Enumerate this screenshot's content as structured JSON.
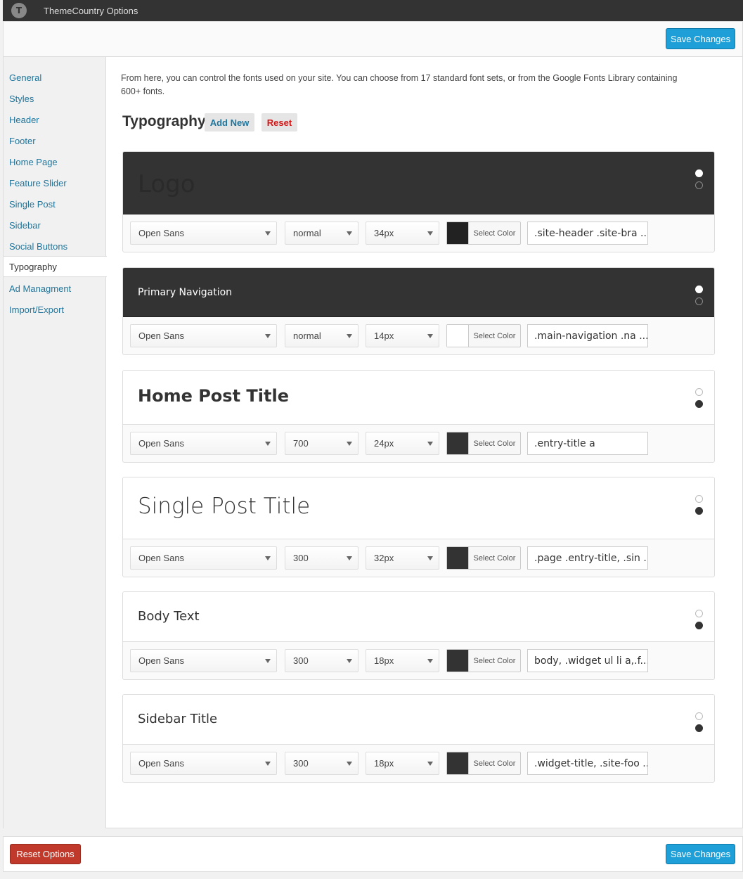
{
  "app": {
    "title": "ThemeCountry Options",
    "logo_glyph": "T"
  },
  "header": {
    "save_label": "Save Changes"
  },
  "sidebar": {
    "items": [
      {
        "label": "General"
      },
      {
        "label": "Styles"
      },
      {
        "label": "Header"
      },
      {
        "label": "Footer"
      },
      {
        "label": "Home Page"
      },
      {
        "label": "Feature Slider"
      },
      {
        "label": "Single Post"
      },
      {
        "label": "Sidebar"
      },
      {
        "label": "Social Buttons"
      },
      {
        "label": "Typography",
        "active": true
      },
      {
        "label": "Ad Managment"
      },
      {
        "label": "Import/Export"
      }
    ]
  },
  "main": {
    "intro": "From here, you can control the fonts used on your site. You can choose from 17 standard font sets, or from the Google Fonts Library containing 600+ fonts.",
    "section_title": "Typography",
    "add_new_label": "Add New",
    "reset_label": "Reset",
    "color_button_label": "Select Color",
    "cards": [
      {
        "preview": "Logo",
        "font": "Open Sans",
        "weight": "normal",
        "size": "34px",
        "color": "#222222",
        "selector": ".site-header .site-bra ..."
      },
      {
        "preview": "Primary Navigation",
        "font": "Open Sans",
        "weight": "normal",
        "size": "14px",
        "color": "#ffffff",
        "selector": ".main-navigation .na  ..."
      },
      {
        "preview": "Home Post Title",
        "font": "Open Sans",
        "weight": "700",
        "size": "24px",
        "color": "#333333",
        "selector": ".entry-title a"
      },
      {
        "preview": "Single Post Title",
        "font": "Open Sans",
        "weight": "300",
        "size": "32px",
        "color": "#333333",
        "selector": ".page .entry-title, .sin ..."
      },
      {
        "preview": "Body Text",
        "font": "Open Sans",
        "weight": "300",
        "size": "18px",
        "color": "#333333",
        "selector": "body, .widget ul li a,.f..."
      },
      {
        "preview": "Sidebar Title",
        "font": "Open Sans",
        "weight": "300",
        "size": "18px",
        "color": "#333333",
        "selector": ".widget-title, .site-foo ..."
      }
    ]
  },
  "footer": {
    "reset_options_label": "Reset Options",
    "save_label": "Save Changes"
  },
  "colors": {
    "primary_button": "#1e9fd8",
    "danger_button": "#c0392b",
    "topbar": "#333333",
    "link": "#21759b"
  }
}
